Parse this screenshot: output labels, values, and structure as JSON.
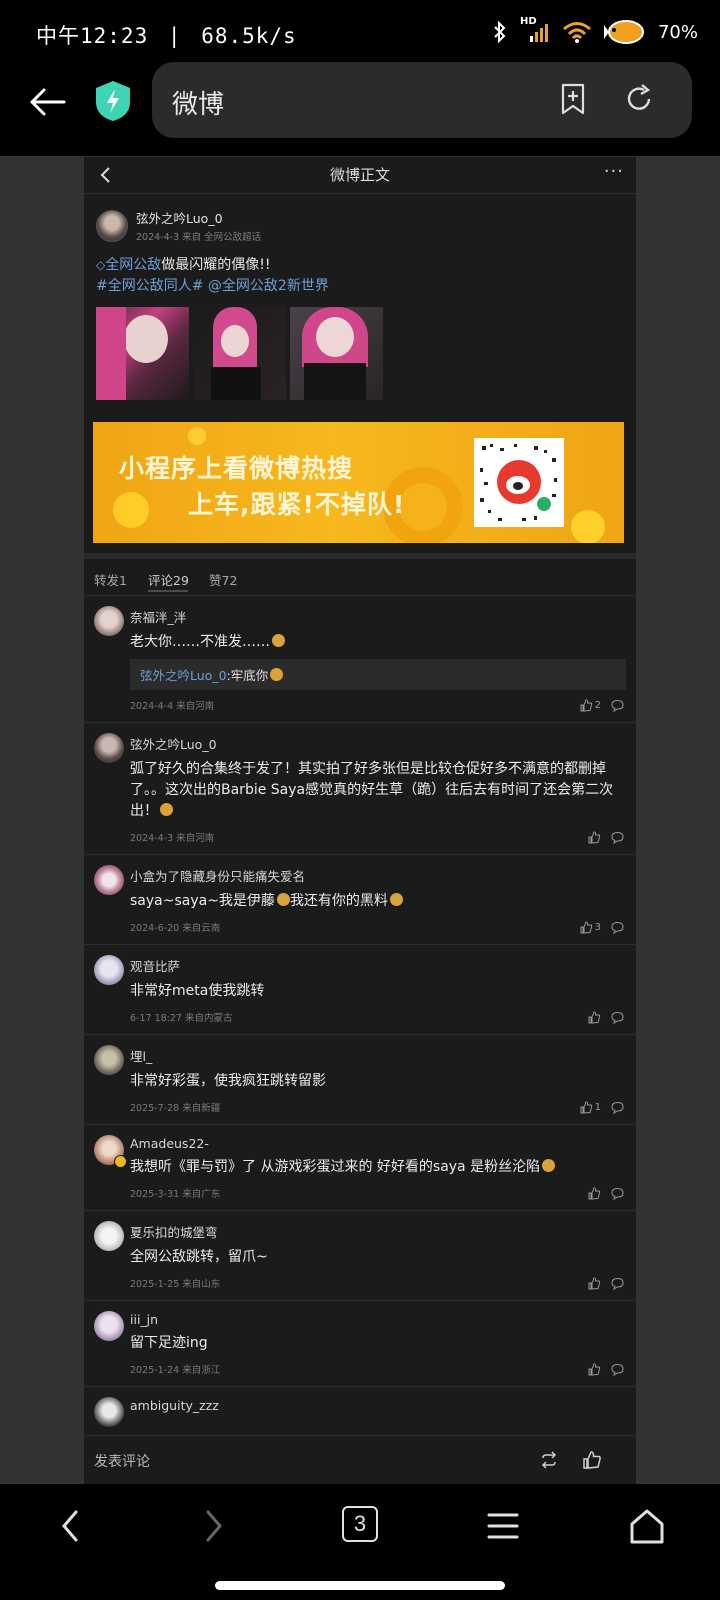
{
  "status_bar": {
    "time": "中午12:23",
    "speed": "68.5k/s",
    "battery": "70%",
    "signal_badge": "HD"
  },
  "browser": {
    "url_text": "微博"
  },
  "page": {
    "title": "微博正文",
    "more_label": "···"
  },
  "post": {
    "author": "弦外之吟Luo_0",
    "date": "2024-4-3",
    "source": "来自 全网公敌超话",
    "text_link": "全网公敌",
    "text_rest": "做最闪耀的偶像!!",
    "topic": "#全网公敌同人#",
    "mention": "@全网公敌2新世界"
  },
  "banner": {
    "line1": "小程序上看微博热搜",
    "line2": "上车,跟紧!不掉队!"
  },
  "tabs": [
    {
      "label": "转发1"
    },
    {
      "label": "评论29"
    },
    {
      "label": "赞72"
    }
  ],
  "comments": [
    {
      "name": "奈福泮_泮",
      "text": "老大你……不准发……",
      "reply_user": "弦外之吟Luo_0",
      "reply_text": ":牢底你",
      "time": "2024-4-4",
      "loc": "来自河南",
      "likes": "2"
    },
    {
      "name": "弦外之吟Luo_0",
      "text": "弧了好久的合集终于发了！其实拍了好多张但是比较仓促好多不满意的都删掉了。。这次出的Barbie Saya感觉真的好生草（跪）往后去有时间了还会第二次出！",
      "time": "2024-4-3",
      "loc": "来自河南",
      "likes": ""
    },
    {
      "name": "小盒为了隐藏身份只能痛失爱名",
      "text": "saya~saya~我是伊藤",
      "text2": "我还有你的黑料",
      "time": "2024-6-20",
      "loc": "来自云南",
      "likes": "3"
    },
    {
      "name": "观音比萨",
      "text": "非常好meta使我跳转",
      "time": "6-17 18:27",
      "loc": "来自内蒙古",
      "likes": ""
    },
    {
      "name": "埋l_",
      "text": "非常好彩蛋，使我疯狂跳转留影",
      "time": "2025-7-28",
      "loc": "来自新疆",
      "likes": "1"
    },
    {
      "name": "Amadeus22-",
      "text": "我想听《罪与罚》了 从游戏彩蛋过来的 好好看的saya 是粉丝沦陷",
      "time": "2025-3-31",
      "loc": "来自广东",
      "likes": ""
    },
    {
      "name": "夏乐扣的城堡弯",
      "text": "全网公敌跳转，留爪~",
      "time": "2025-1-25",
      "loc": "来自山东",
      "likes": ""
    },
    {
      "name": "iii_jn",
      "text": "留下足迹ing",
      "time": "2025-1-24",
      "loc": "来自浙江",
      "likes": ""
    },
    {
      "name": "ambiguity_zzz",
      "text": "",
      "time": "",
      "loc": "",
      "likes": ""
    }
  ],
  "comment_input": {
    "placeholder": "发表评论"
  },
  "nav": {
    "tab_count": "3"
  },
  "colors": {
    "link": "#6f9fd8",
    "banner": "#f2aa16",
    "shield": "#3fd4b4"
  }
}
